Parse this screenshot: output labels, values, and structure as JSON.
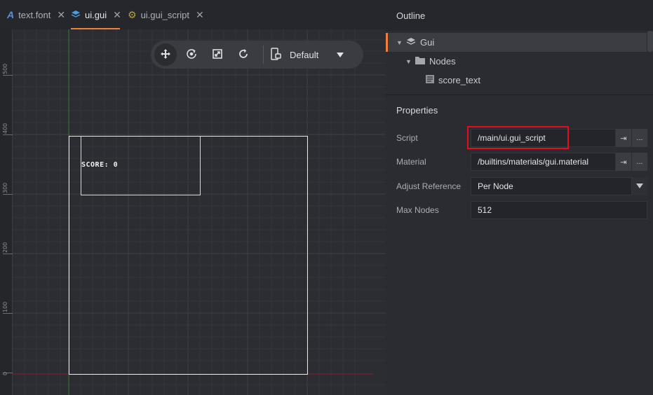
{
  "tabs": [
    {
      "label": "text.font",
      "icon": "font-icon"
    },
    {
      "label": "ui.gui",
      "icon": "gui-icon"
    },
    {
      "label": "ui.gui_script",
      "icon": "gear-icon"
    }
  ],
  "ruler": {
    "labels": [
      "500",
      "400",
      "300",
      "200",
      "100",
      "0"
    ]
  },
  "canvas": {
    "score_text": "SCORE: 0"
  },
  "toolbar": {
    "layout_label": "Default"
  },
  "outline": {
    "title": "Outline",
    "items": [
      {
        "label": "Gui",
        "icon": "gui-icon"
      },
      {
        "label": "Nodes",
        "icon": "folder-icon"
      },
      {
        "label": "score_text",
        "icon": "text-node-icon"
      }
    ]
  },
  "properties": {
    "title": "Properties",
    "script": {
      "label": "Script",
      "value": "/main/ui.gui_script"
    },
    "material": {
      "label": "Material",
      "value": "/builtins/materials/gui.material"
    },
    "adjust_reference": {
      "label": "Adjust Reference",
      "value": "Per Node"
    },
    "max_nodes": {
      "label": "Max Nodes",
      "value": "512"
    },
    "more_label": "..."
  },
  "colors": {
    "accent": "#ef7f3b",
    "highlight": "#e0101a"
  }
}
